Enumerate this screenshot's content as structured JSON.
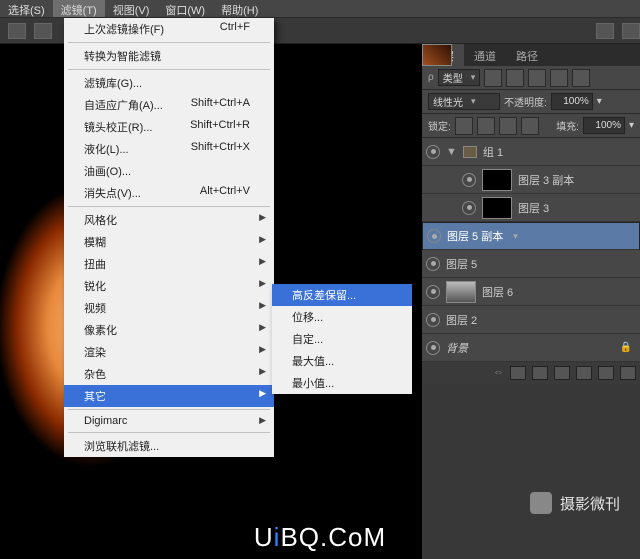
{
  "menubar": {
    "items": [
      "选择(S)",
      "滤镜(T)",
      "视图(V)",
      "窗口(W)",
      "帮助(H)"
    ],
    "active_index": 1
  },
  "menu": {
    "items": [
      {
        "label": "上次滤镜操作(F)",
        "shortcut": "Ctrl+F",
        "sep_after": true
      },
      {
        "label": "转换为智能滤镜",
        "sep_after": true
      },
      {
        "label": "滤镜库(G)..."
      },
      {
        "label": "自适应广角(A)...",
        "shortcut": "Shift+Ctrl+A"
      },
      {
        "label": "镜头校正(R)...",
        "shortcut": "Shift+Ctrl+R"
      },
      {
        "label": "液化(L)...",
        "shortcut": "Shift+Ctrl+X"
      },
      {
        "label": "油画(O)..."
      },
      {
        "label": "消失点(V)...",
        "shortcut": "Alt+Ctrl+V",
        "sep_after": true
      },
      {
        "label": "风格化",
        "submenu": true
      },
      {
        "label": "模糊",
        "submenu": true
      },
      {
        "label": "扭曲",
        "submenu": true
      },
      {
        "label": "锐化",
        "submenu": true
      },
      {
        "label": "视频",
        "submenu": true
      },
      {
        "label": "像素化",
        "submenu": true
      },
      {
        "label": "渲染",
        "submenu": true
      },
      {
        "label": "杂色",
        "submenu": true
      },
      {
        "label": "其它",
        "submenu": true,
        "highlight": true,
        "sep_after": true
      },
      {
        "label": "Digimarc",
        "submenu": true,
        "sep_after": true
      },
      {
        "label": "浏览联机滤镜..."
      }
    ]
  },
  "submenu": {
    "items": [
      {
        "label": "高反差保留...",
        "highlight": true
      },
      {
        "label": "位移..."
      },
      {
        "label": "自定..."
      },
      {
        "label": "最大值..."
      },
      {
        "label": "最小值..."
      }
    ]
  },
  "layers_panel": {
    "tabs": [
      "图层",
      "通道",
      "路径"
    ],
    "active_tab": 0,
    "kind_label": "类型",
    "mode_label": "线性光",
    "opacity_label": "不透明度:",
    "opacity_value": "100%",
    "lock_label": "锁定:",
    "fill_label": "填充:",
    "fill_value": "100%",
    "layers": [
      {
        "label": "组 1",
        "type": "group"
      },
      {
        "label": "图层 3 副本",
        "indent": true,
        "thumb": "black"
      },
      {
        "label": "图层 3",
        "indent": true,
        "thumb": "black"
      },
      {
        "label": "图层 5 副本",
        "thumb": "face",
        "selected": true
      },
      {
        "label": "图层 5",
        "thumb": "face"
      },
      {
        "label": "图层 6",
        "thumb": "bw"
      },
      {
        "label": "图层 2",
        "thumb": "face"
      },
      {
        "label": "背景",
        "thumb": "face",
        "locked": true,
        "italic": true
      }
    ]
  },
  "watermark": {
    "channel": "摄影微刊",
    "site_prefix": "U",
    "site_i": "i",
    "site_rest": "BQ.CoM"
  }
}
